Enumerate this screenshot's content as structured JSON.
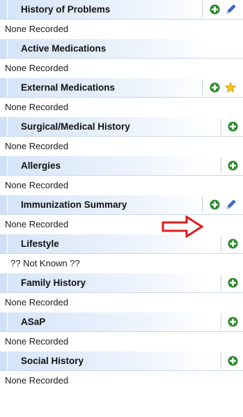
{
  "sections": [
    {
      "title": "History of Problems",
      "content": "None Recorded",
      "icons": [
        "add-icon",
        "edit-icon"
      ]
    },
    {
      "title": "Active Medications",
      "content": "None Recorded",
      "icons": []
    },
    {
      "title": "External Medications",
      "content": "None Recorded",
      "icons": [
        "add-icon",
        "star-icon"
      ]
    },
    {
      "title": "Surgical/Medical History",
      "content": "None Recorded",
      "icons": [
        "add-icon"
      ]
    },
    {
      "title": "Allergies",
      "content": "None Recorded",
      "icons": [
        "add-icon"
      ]
    },
    {
      "title": "Immunization Summary",
      "content": "None Recorded",
      "icons": [
        "add-icon",
        "edit-icon"
      ]
    },
    {
      "title": "Lifestyle",
      "content": "?? Not Known ??",
      "icons": [
        "add-icon"
      ]
    },
    {
      "title": "Family History",
      "content": "None Recorded",
      "icons": [
        "add-icon"
      ]
    },
    {
      "title": "ASaP",
      "content": "None Recorded",
      "icons": [
        "add-icon"
      ]
    },
    {
      "title": "Social History",
      "content": "None Recorded",
      "icons": [
        "add-icon"
      ]
    }
  ],
  "colors": {
    "add_green": "#2e8b2e",
    "edit_blue": "#3b6fd4",
    "star_yellow": "#f5c518",
    "annotation_red": "#e01b1b",
    "header_blue": "#d6e5f9"
  },
  "annotation": {
    "icon": "red-arrow-icon"
  }
}
